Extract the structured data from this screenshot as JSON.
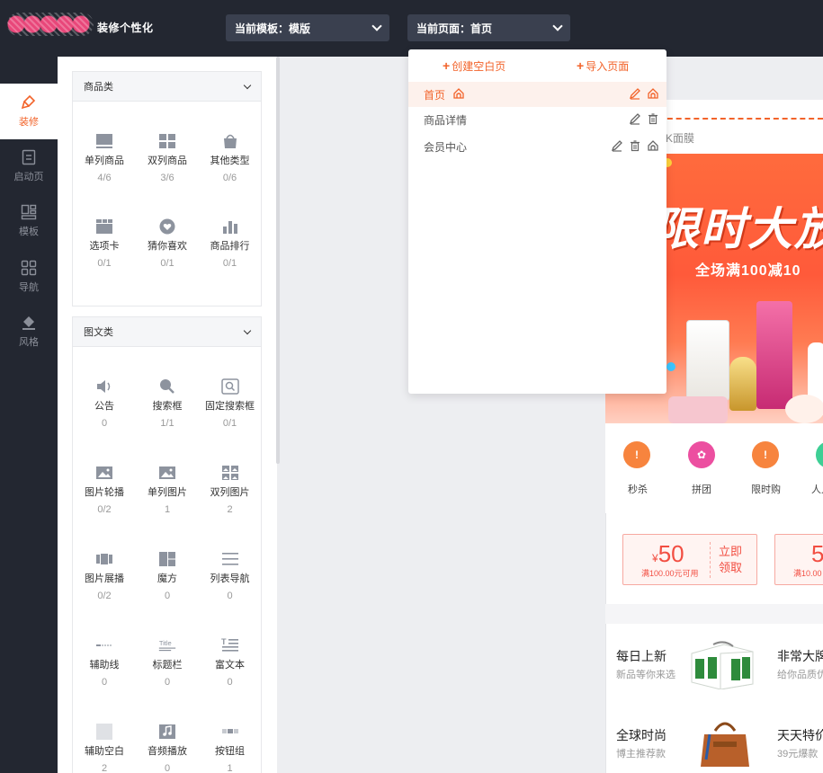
{
  "header": {
    "site_title": "装修个性化",
    "template_label": "当前模板：模版",
    "page_label": "当前页面：首页"
  },
  "nav": {
    "items": [
      {
        "label": "装修",
        "icon": "brush-icon",
        "active": true
      },
      {
        "label": "启动页",
        "icon": "document-icon",
        "active": false
      },
      {
        "label": "模板",
        "icon": "template-icon",
        "active": false
      },
      {
        "label": "导航",
        "icon": "grid-icon",
        "active": false
      },
      {
        "label": "风格",
        "icon": "paint-bucket-icon",
        "active": false
      }
    ]
  },
  "groups": [
    {
      "title": "商品类",
      "items": [
        {
          "label": "单列商品",
          "count": "4/6",
          "icon": "single-column-goods-icon"
        },
        {
          "label": "双列商品",
          "count": "3/6",
          "icon": "double-column-goods-icon"
        },
        {
          "label": "其他类型",
          "count": "0/6",
          "icon": "bag-icon"
        },
        {
          "label": "选项卡",
          "count": "0/1",
          "icon": "tab-icon"
        },
        {
          "label": "猜你喜欢",
          "count": "0/1",
          "icon": "heart-icon"
        },
        {
          "label": "商品排行",
          "count": "0/1",
          "icon": "ranking-icon"
        }
      ]
    },
    {
      "title": "图文类",
      "items": [
        {
          "label": "公告",
          "count": "0",
          "icon": "speaker-icon"
        },
        {
          "label": "搜索框",
          "count": "1/1",
          "icon": "search-icon"
        },
        {
          "label": "固定搜索框",
          "count": "0/1",
          "icon": "fixed-search-icon"
        },
        {
          "label": "图片轮播",
          "count": "0/2",
          "icon": "carousel-icon"
        },
        {
          "label": "单列图片",
          "count": "1",
          "icon": "image-icon"
        },
        {
          "label": "双列图片",
          "count": "2",
          "icon": "double-image-icon"
        },
        {
          "label": "图片展播",
          "count": "0/2",
          "icon": "image-showcase-icon"
        },
        {
          "label": "魔方",
          "count": "0",
          "icon": "cube-icon"
        },
        {
          "label": "列表导航",
          "count": "0",
          "icon": "list-icon"
        },
        {
          "label": "辅助线",
          "count": "0",
          "icon": "divider-line-icon"
        },
        {
          "label": "标题栏",
          "count": "0",
          "icon": "title-icon"
        },
        {
          "label": "富文本",
          "count": "0",
          "icon": "rich-text-icon"
        },
        {
          "label": "辅助空白",
          "count": "2",
          "icon": "blank-icon"
        },
        {
          "label": "音频播放",
          "count": "0",
          "icon": "music-icon"
        },
        {
          "label": "按钮组",
          "count": "1",
          "icon": "button-group-icon"
        }
      ]
    }
  ],
  "popup": {
    "create_label": "创建空白页",
    "import_label": "导入页面",
    "pages": [
      {
        "name": "首页",
        "current": true
      },
      {
        "name": "商品详情",
        "current": false
      },
      {
        "name": "会员中心",
        "current": false
      }
    ]
  },
  "preview": {
    "search_hint": "K面膜",
    "banner_title": "限时大放",
    "banner_sub": "全场满100减10",
    "shortcuts": [
      {
        "label": "秒杀",
        "color": "#f7843e"
      },
      {
        "label": "拼团",
        "color": "#ec4fa0"
      },
      {
        "label": "限时购",
        "color": "#f7843e"
      },
      {
        "label": "人人",
        "color": "#3ecf95"
      }
    ],
    "coupon": {
      "currency": "¥",
      "amount": "50",
      "condition": "满100.00元可用",
      "take_label": "立即领取",
      "amount2": "5",
      "condition2": "满10.00"
    },
    "features": [
      {
        "title": "每日上新",
        "sub": "新品等你来选"
      },
      {
        "title": "非常大牌",
        "sub": "给你品质优"
      },
      {
        "title": "全球时尚",
        "sub": "博主推荐款"
      },
      {
        "title": "天天特价",
        "sub": "39元爆款"
      }
    ]
  },
  "colors": {
    "accent": "#f2632a",
    "topbar": "#232731",
    "dropdown": "#3a404f"
  }
}
